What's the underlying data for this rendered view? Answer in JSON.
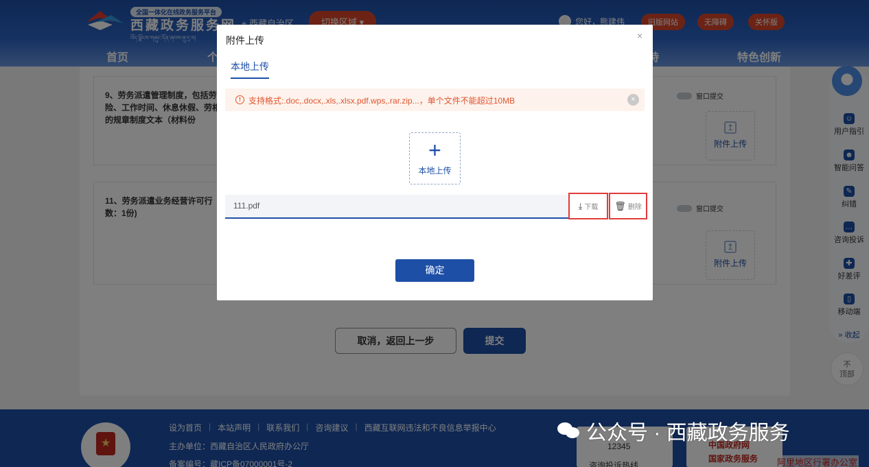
{
  "header": {
    "slogan": "全国一体化在线政务服务平台",
    "site_title": "西藏政务服务网",
    "tibetan_line": "བོད་ལྗོངས་གཞུང་དོན་ཞབས་ཞུ་དྲ་བ།",
    "region": "西藏自治区",
    "switch_region": "切换区域",
    "greeting": "您好，熊建伟",
    "buttons": [
      "旧版网站",
      "无障碍",
      "关怀版"
    ],
    "nav": [
      "首页",
      "个",
      "特",
      "特色创新"
    ]
  },
  "content": {
    "item9": "9、劳务派遣管理制度，包括劳险、工作时间、休息休假、劳相关的规章制度文本（材料份",
    "item11": "11、劳务派遣业务经营许可行数：1份)",
    "window_submit": "窗口提交",
    "attach_upload": "附件上传",
    "cancel": "取消，返回上一步",
    "submit": "提交"
  },
  "sidebar": {
    "items": [
      "用户指引",
      "智能问答",
      "纠错",
      "咨询投诉",
      "好差评",
      "移动端"
    ],
    "collapse": "» 收起",
    "top_line1": "不",
    "top_line2": "顶部"
  },
  "footer": {
    "links": [
      "设为首页",
      "本站声明",
      "联系我们",
      "咨询建议",
      "西藏互联网违法和不良信息举报中心"
    ],
    "organizer": "主办单位：西藏自治区人民政府办公厅",
    "icp": "备案编号：藏ICP备07000001号-2",
    "hotline_num": "12345",
    "hotline_label": "咨询投诉热线",
    "gov_site": "中国政府网",
    "gov_service": "国家政务服务",
    "office": "阿里地区行署办公室"
  },
  "watermark": "公众号 · 西藏政务服务",
  "modal": {
    "title": "附件上传",
    "close": "×",
    "tab": "本地上传",
    "alert_text": "支持格式:.doc,.docx,.xls,.xlsx.pdf.wps,.rar.zip...，单个文件不能超过10MB",
    "upload_label": "本地上传",
    "file_name": "111.pdf",
    "download": "下载",
    "delete": "删除",
    "confirm": "确定"
  }
}
